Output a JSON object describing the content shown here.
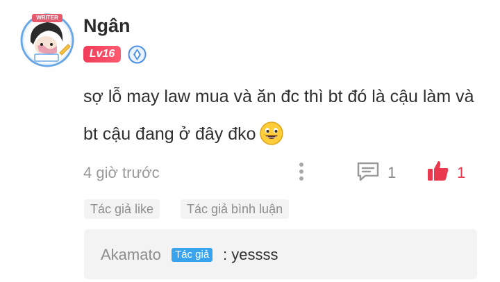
{
  "comment": {
    "username": "Ngân",
    "avatar_badge_text": "WRITER",
    "level": "Lv16",
    "text": "sợ lỗ may law mua và ăn đc thì bt đó là cậu làm và bt cậu đang ở đây đko",
    "emoji": "grinning-face",
    "timestamp": "4 giờ trước",
    "reply_count": "1",
    "like_count": "1",
    "icons": {
      "more": "more-vertical-icon",
      "reply": "comment-bubble-icon",
      "like": "thumbs-up-icon",
      "verify": "verified-badge-icon"
    },
    "colors": {
      "level_badge": "#f03c5a",
      "like": "#e8394f",
      "verify": "#4a90e2",
      "author_badge": "#3aa3ee"
    }
  },
  "tags": {
    "author_liked": "Tác giả like",
    "author_commented": "Tác giả bình luận"
  },
  "reply": {
    "author": "Akamato",
    "author_badge": "Tác giả",
    "text": ": yessss"
  }
}
